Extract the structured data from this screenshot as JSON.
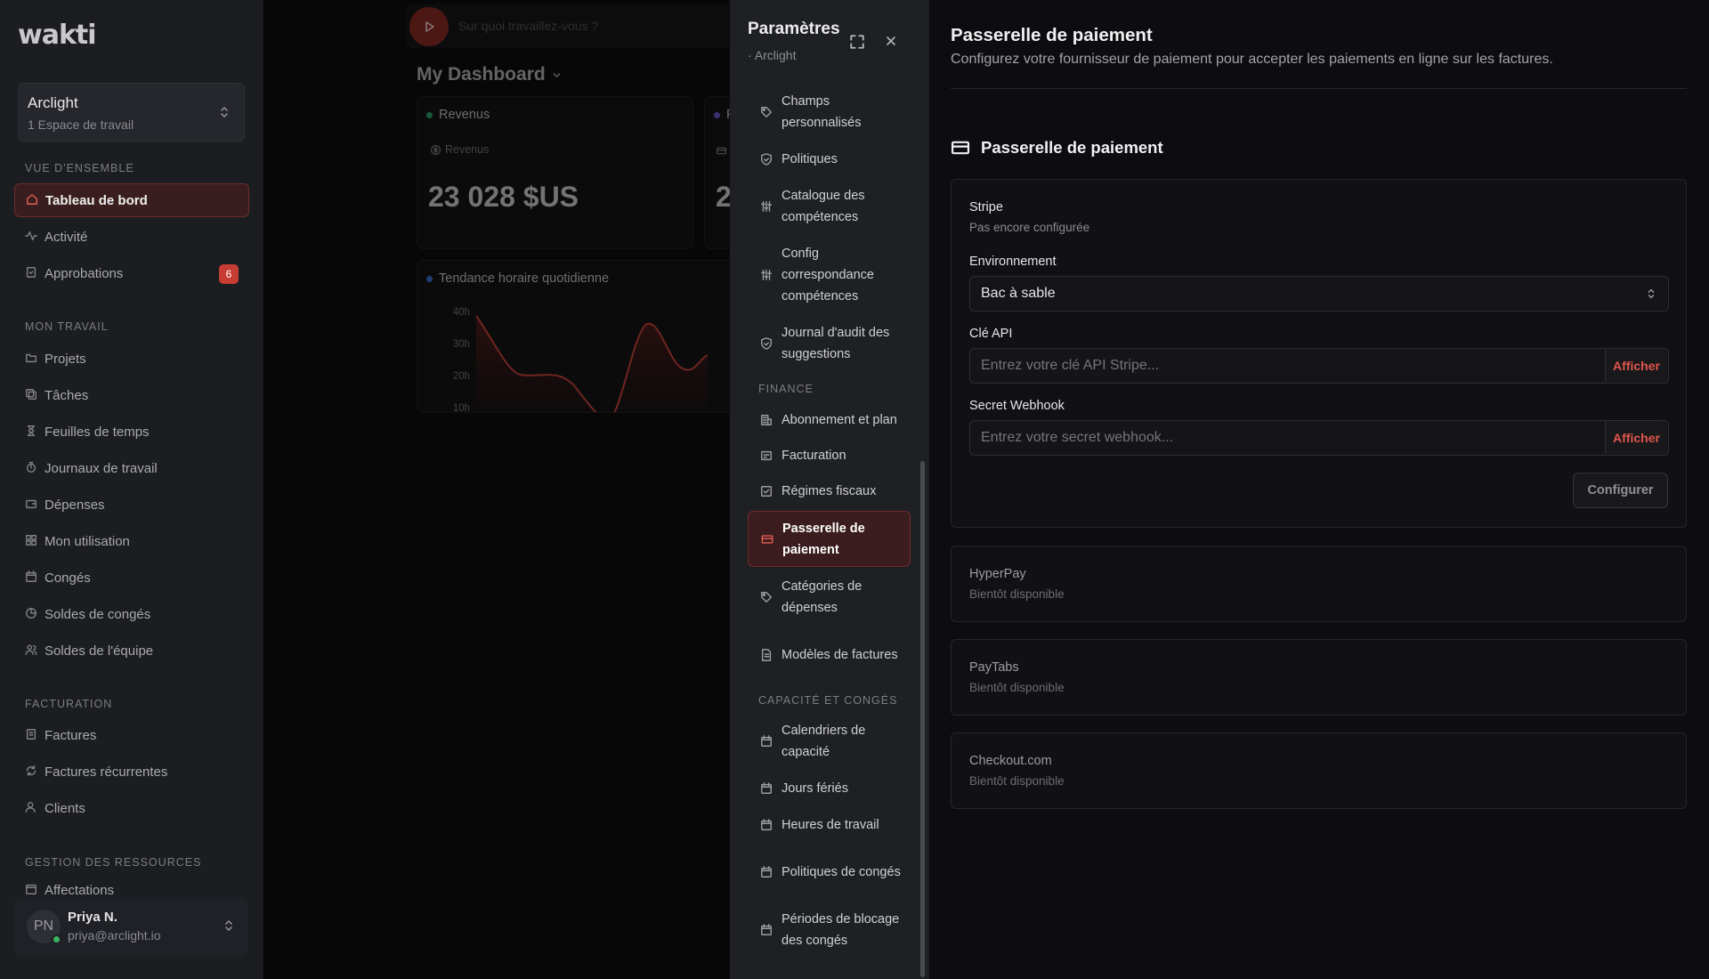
{
  "sidebar": {
    "logo": "wakti",
    "workspace": {
      "name": "Arclight",
      "sub": "1 Espace de travail"
    },
    "sections": {
      "overview": "VUE D'ENSEMBLE",
      "my_work": "MON TRAVAIL",
      "billing": "FACTURATION",
      "resources": "GESTION DES RESSOURCES"
    },
    "items": {
      "dashboard": "Tableau de bord",
      "activity": "Activité",
      "approvals": "Approbations",
      "approvals_badge": "6",
      "projects": "Projets",
      "tasks": "Tâches",
      "timesheets": "Feuilles de temps",
      "worklogs": "Journaux de travail",
      "expenses": "Dépenses",
      "usage": "Mon utilisation",
      "leave": "Congés",
      "leave_balances": "Soldes de congés",
      "team_balances": "Soldes de l'équipe",
      "invoices": "Factures",
      "recurring_invoices": "Factures récurrentes",
      "clients": "Clients",
      "assignments": "Affectations"
    },
    "user": {
      "initials": "PN",
      "name": "Priya N.",
      "email": "priya@arclight.io"
    }
  },
  "dashboard": {
    "timer_placeholder": "Sur quoi travaillez-vous ?",
    "title": "My Dashboard",
    "revenue_card": {
      "title": "Revenus",
      "sub": "Revenus",
      "value": "23 028 $US"
    },
    "second_card": {
      "title": "F",
      "value": "2"
    },
    "trend_card": {
      "title": "Tendance horaire quotidienne",
      "axis": [
        "40h",
        "30h",
        "20h",
        "10h"
      ]
    },
    "colors": {
      "revenue_dot": "#2fa06a",
      "trend_dot": "#3e6fd1",
      "second_dot": "#6a5acd"
    }
  },
  "settings_nav": {
    "title": "Paramètres",
    "sub": "· Arclight",
    "items": {
      "custom_fields": "Champs personnalisés",
      "policies": "Politiques",
      "skills_catalog": "Catalogue des compétences",
      "skills_mapping": "Config correspondance compétences",
      "audit_log": "Journal d'audit des suggestions",
      "subscription": "Abonnement et plan",
      "invoicing": "Facturation",
      "tax": "Régimes fiscaux",
      "payment_gateway": "Passerelle de paiement",
      "expense_categories": "Catégories de dépenses",
      "invoice_templates": "Modèles de factures",
      "capacity_calendars": "Calendriers de capacité",
      "holidays": "Jours fériés",
      "working_hours": "Heures de travail",
      "leave_policies": "Politiques de congés",
      "blackout_periods": "Périodes de blocage des congés"
    },
    "sections": {
      "finance": "FINANCE",
      "capacity": "CAPACITÉ ET CONGÉS"
    }
  },
  "main": {
    "title": "Passerelle de paiement",
    "description": "Configurez votre fournisseur de paiement pour accepter les paiements en ligne sur les factures.",
    "section_title": "Passerelle de paiement",
    "stripe": {
      "name": "Stripe",
      "status": "Pas encore configurée",
      "env_label": "Environnement",
      "env_value": "Bac à sable",
      "api_label": "Clé API",
      "api_placeholder": "Entrez votre clé API Stripe...",
      "webhook_label": "Secret Webhook",
      "webhook_placeholder": "Entrez votre secret webhook...",
      "show_label": "Afficher",
      "configure_label": "Configurer"
    },
    "providers": [
      {
        "name": "HyperPay",
        "status": "Bientôt disponible"
      },
      {
        "name": "PayTabs",
        "status": "Bientôt disponible"
      },
      {
        "name": "Checkout.com",
        "status": "Bientôt disponible"
      }
    ],
    "accent_color": "#e0564b"
  }
}
